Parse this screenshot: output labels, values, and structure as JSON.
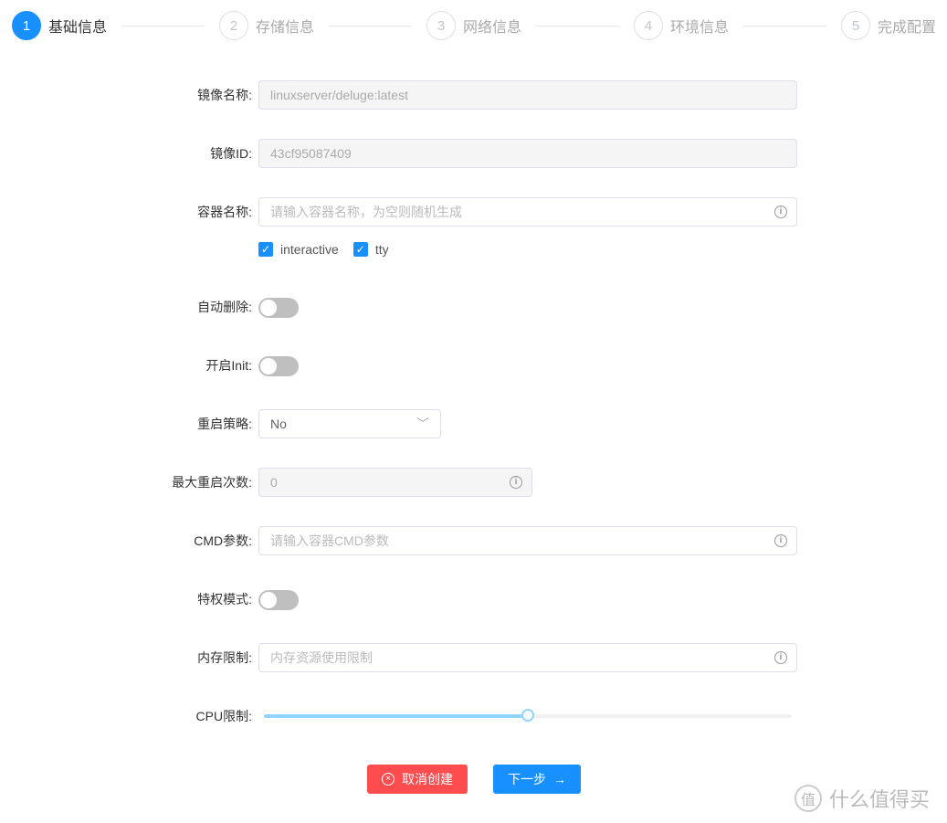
{
  "steps": [
    {
      "num": "1",
      "label": "基础信息",
      "active": true
    },
    {
      "num": "2",
      "label": "存储信息"
    },
    {
      "num": "3",
      "label": "网络信息"
    },
    {
      "num": "4",
      "label": "环境信息"
    },
    {
      "num": "5",
      "label": "完成配置"
    }
  ],
  "form": {
    "image_name": {
      "label": "镜像名称:",
      "value": "linuxserver/deluge:latest"
    },
    "image_id": {
      "label": "镜像ID:",
      "value": "43cf95087409"
    },
    "container_name": {
      "label": "容器名称:",
      "placeholder": "请输入容器名称，为空则随机生成"
    },
    "checkboxes": [
      {
        "label": "interactive",
        "checked": true
      },
      {
        "label": "tty",
        "checked": true
      }
    ],
    "auto_remove": {
      "label": "自动删除:",
      "on": false
    },
    "init": {
      "label": "开启Init:",
      "on": false
    },
    "restart_policy": {
      "label": "重启策略:",
      "value": "No"
    },
    "max_restart": {
      "label": "最大重启次数:",
      "value": "0"
    },
    "cmd": {
      "label": "CMD参数:",
      "placeholder": "请输入容器CMD参数"
    },
    "privileged": {
      "label": "特权模式:",
      "on": false
    },
    "memory": {
      "label": "内存限制:",
      "placeholder": "内存资源使用限制"
    },
    "cpu": {
      "label": "CPU限制:",
      "value_percent": 50
    }
  },
  "buttons": {
    "cancel": "取消创建",
    "next": "下一步"
  },
  "watermark": "什么值得买",
  "colors": {
    "primary": "#1890ff",
    "danger": "#ff4d4f"
  }
}
